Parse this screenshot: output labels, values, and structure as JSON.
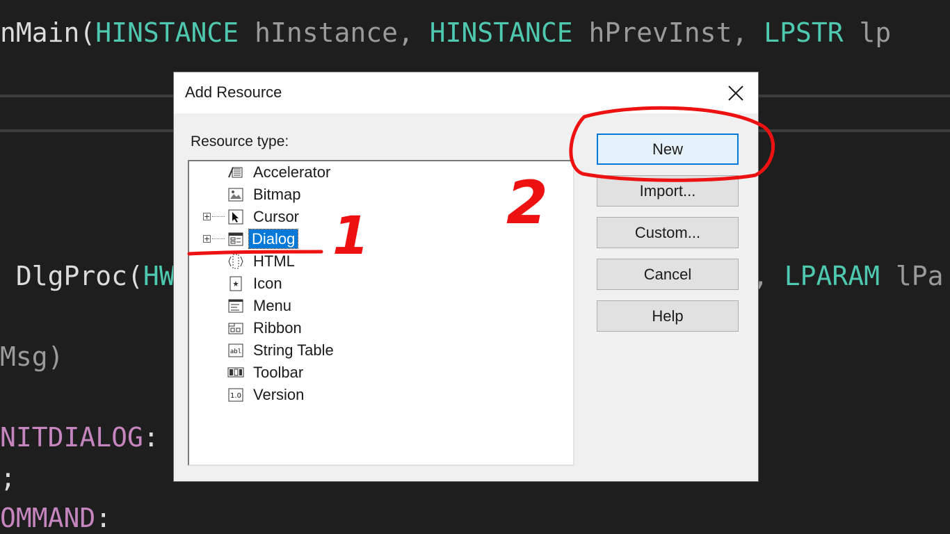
{
  "editor": {
    "line1": [
      {
        "t": "nMain(",
        "c": "tk-fn"
      },
      {
        "t": "HINSTANCE",
        "c": "tk-type"
      },
      {
        "t": " hInstance, ",
        "c": "tk-param"
      },
      {
        "t": "HINSTANCE",
        "c": "tk-type"
      },
      {
        "t": " hPrevInst, ",
        "c": "tk-param"
      },
      {
        "t": "LPSTR",
        "c": "tk-type"
      },
      {
        "t": " lp",
        "c": "tk-param"
      }
    ],
    "line2_left": [
      {
        "t": " DlgProc(",
        "c": "tk-fn"
      },
      {
        "t": "HW",
        "c": "tk-type"
      }
    ],
    "line2_right": [
      {
        "t": ", ",
        "c": "tk-param"
      },
      {
        "t": "LPARAM",
        "c": "tk-type"
      },
      {
        "t": " lPa",
        "c": "tk-param"
      }
    ],
    "line3": [
      {
        "t": "Msg)",
        "c": "tk-param"
      }
    ],
    "line4": [
      {
        "t": "NITDIALOG",
        "c": "tk-macro"
      },
      {
        "t": ":",
        "c": "tk-plain"
      }
    ],
    "line5": [
      {
        "t": ";",
        "c": "tk-plain"
      }
    ],
    "line6": [
      {
        "t": "OMMAND",
        "c": "tk-macro"
      },
      {
        "t": ":",
        "c": "tk-plain"
      }
    ]
  },
  "dialog": {
    "title": "Add Resource",
    "resource_type_label": "Resource type:",
    "items": [
      {
        "label": "Accelerator",
        "icon": "accelerator-icon",
        "expandable": false,
        "selected": false
      },
      {
        "label": "Bitmap",
        "icon": "bitmap-icon",
        "expandable": false,
        "selected": false
      },
      {
        "label": "Cursor",
        "icon": "cursor-icon",
        "expandable": true,
        "selected": false
      },
      {
        "label": "Dialog",
        "icon": "dialog-icon",
        "expandable": true,
        "selected": true
      },
      {
        "label": "HTML",
        "icon": "html-icon",
        "expandable": false,
        "selected": false
      },
      {
        "label": "Icon",
        "icon": "icon-resource-icon",
        "expandable": false,
        "selected": false
      },
      {
        "label": "Menu",
        "icon": "menu-icon",
        "expandable": false,
        "selected": false
      },
      {
        "label": "Ribbon",
        "icon": "ribbon-icon",
        "expandable": false,
        "selected": false
      },
      {
        "label": "String Table",
        "icon": "string-table-icon",
        "expandable": false,
        "selected": false
      },
      {
        "label": "Toolbar",
        "icon": "toolbar-icon",
        "expandable": false,
        "selected": false
      },
      {
        "label": "Version",
        "icon": "version-icon",
        "expandable": false,
        "selected": false
      }
    ],
    "buttons": {
      "new": "New",
      "import": "Import...",
      "custom": "Custom...",
      "cancel": "Cancel",
      "help": "Help"
    },
    "expander_glyph": "+"
  },
  "annotations": {
    "step1": "1",
    "step2": "2",
    "color": "#ee1111"
  },
  "colors": {
    "selection": "#0078d7",
    "editor_bg": "#1e1e1e"
  }
}
